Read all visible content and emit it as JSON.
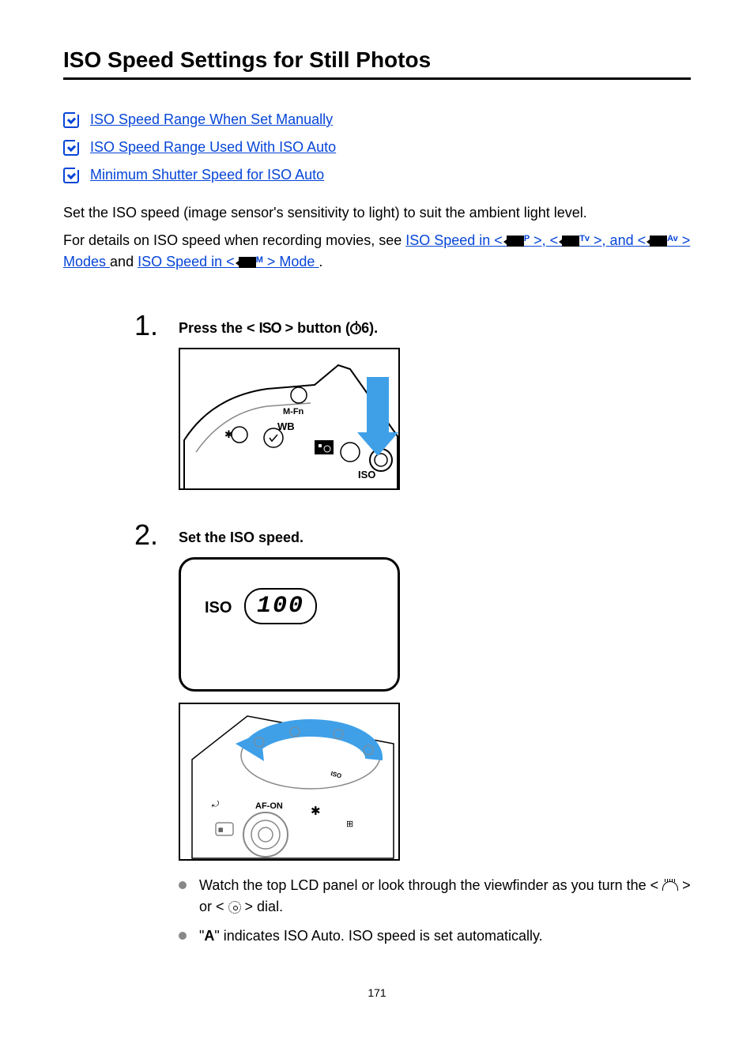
{
  "title": "ISO Speed Settings for Still Photos",
  "toc": [
    {
      "label": "ISO Speed Range When Set Manually"
    },
    {
      "label": "ISO Speed Range Used With ISO Auto"
    },
    {
      "label": "Minimum Shutter Speed for ISO Auto"
    }
  ],
  "intro": {
    "line1": "Set the ISO speed (image sensor's sensitivity to light) to suit the ambient light level.",
    "line2_pre": "For details on ISO speed when recording movies, see ",
    "link1_pre": "ISO Speed in < ",
    "link1_sup_p": "P",
    "link1_mid": " >, < ",
    "link1_sup_tv": "Tv",
    "link1_post": " >, and < ",
    "link1_sup_av": "Av",
    "link1_end": " > Modes",
    "between": " and ",
    "link2_pre": "ISO Speed in < ",
    "link2_sup_m": "M",
    "link2_end": " > Mode",
    "period": "."
  },
  "steps": {
    "s1": {
      "num": "1.",
      "title_pre": "Press the < ",
      "title_iso": "ISO",
      "title_mid": " > button (",
      "title_timer_num": "6",
      "title_post": ").",
      "illus": {
        "mfn": "M-Fn",
        "wb": "WB",
        "iso": "ISO"
      }
    },
    "s2": {
      "num": "2.",
      "title": "Set the ISO speed.",
      "lcd_iso": "ISO",
      "lcd_val": "100",
      "dial": {
        "afon": "AF-ON",
        "star": "✱"
      },
      "bullets": {
        "b1_pre": "Watch the top LCD panel or look through the viewfinder as you turn the < ",
        "b1_mid": " > or < ",
        "b1_post": " > dial.",
        "b2_pre": "\"",
        "b2_a": "A",
        "b2_post": "\" indicates ISO Auto. ISO speed is set automatically."
      }
    }
  },
  "page_number": "171"
}
